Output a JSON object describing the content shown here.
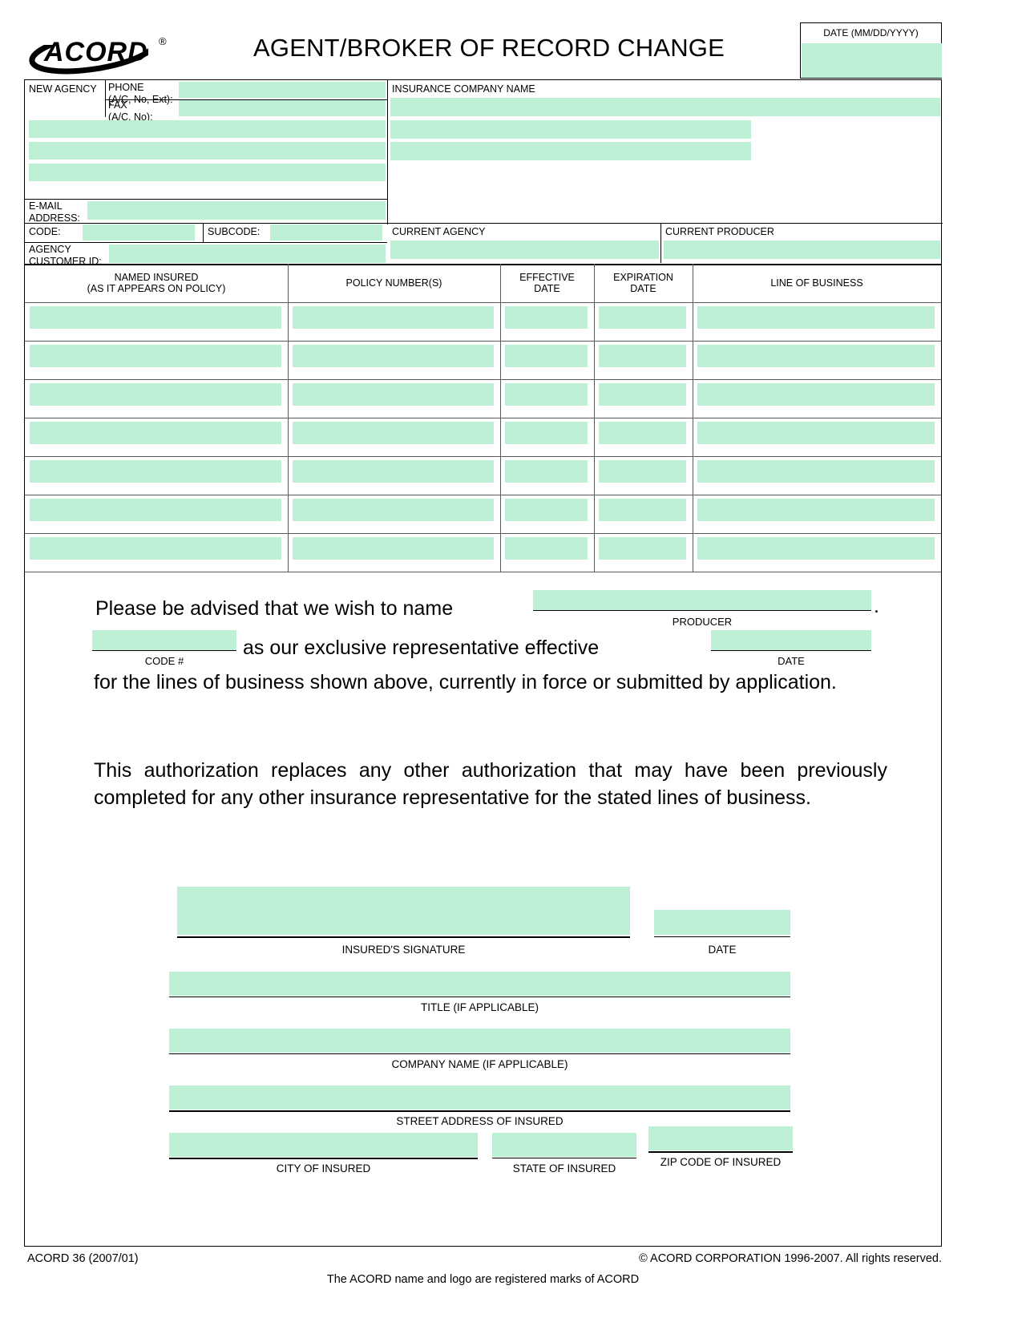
{
  "header": {
    "logo_text": "ACORD",
    "logo_reg": "®",
    "title": "AGENT/BROKER OF RECORD CHANGE",
    "date_label": "DATE (MM/DD/YYYY)",
    "date_value": ""
  },
  "agency": {
    "new_agency_label": "NEW AGENCY",
    "phone_label_l1": "PHONE",
    "phone_label_l2": "(A/C, No, Ext):",
    "phone_value": "",
    "fax_label_l1": "FAX",
    "fax_label_l2": "(A/C, No):",
    "fax_value": "",
    "address_line1": "",
    "address_line2": "",
    "address_line3": "",
    "email_label_l1": "E-MAIL",
    "email_label_l2": "ADDRESS:",
    "email_value": "",
    "code_label": "CODE:",
    "code_value": "",
    "subcode_label": "SUBCODE:",
    "subcode_value": "",
    "customer_id_label_l1": "AGENCY",
    "customer_id_label_l2": "CUSTOMER ID:",
    "customer_id_value": ""
  },
  "insurance": {
    "company_name_label": "INSURANCE COMPANY NAME",
    "company_name_value": "",
    "company_line2": "",
    "company_line3": "",
    "current_agency_label": "CURRENT AGENCY",
    "current_agency_value": "",
    "current_producer_label": "CURRENT PRODUCER",
    "current_producer_value": ""
  },
  "policy_table": {
    "columns": [
      {
        "label_l1": "NAMED INSURED",
        "label_l2": "(AS IT APPEARS ON POLICY)"
      },
      {
        "label_l1": "POLICY NUMBER(S)",
        "label_l2": ""
      },
      {
        "label_l1": "EFFECTIVE",
        "label_l2": "DATE"
      },
      {
        "label_l1": "EXPIRATION",
        "label_l2": "DATE"
      },
      {
        "label_l1": "LINE OF BUSINESS",
        "label_l2": ""
      }
    ],
    "rows": [
      {
        "named_insured": "",
        "policy_number": "",
        "effective_date": "",
        "expiration_date": "",
        "line_of_business": ""
      },
      {
        "named_insured": "",
        "policy_number": "",
        "effective_date": "",
        "expiration_date": "",
        "line_of_business": ""
      },
      {
        "named_insured": "",
        "policy_number": "",
        "effective_date": "",
        "expiration_date": "",
        "line_of_business": ""
      },
      {
        "named_insured": "",
        "policy_number": "",
        "effective_date": "",
        "expiration_date": "",
        "line_of_business": ""
      },
      {
        "named_insured": "",
        "policy_number": "",
        "effective_date": "",
        "expiration_date": "",
        "line_of_business": ""
      },
      {
        "named_insured": "",
        "policy_number": "",
        "effective_date": "",
        "expiration_date": "",
        "line_of_business": ""
      },
      {
        "named_insured": "",
        "policy_number": "",
        "effective_date": "",
        "expiration_date": "",
        "line_of_business": ""
      }
    ]
  },
  "statement": {
    "line1_text": "Please be advised that  we wish to name",
    "producer_value": "",
    "producer_label": "PRODUCER",
    "period": ".",
    "code_value": "",
    "code_label": "CODE #",
    "line2_text": "as our  exclusive representative  effective",
    "effective_date_value": "",
    "effective_date_label": "DATE",
    "line3_text": "for the lines of business shown above, currently in force or submitted by application.",
    "paragraph2": "This authorization replaces any other authorization that may have been previously completed for any other insurance representative for the stated lines of business."
  },
  "signature": {
    "insured_signature_value": "",
    "insured_signature_label": "INSURED'S SIGNATURE",
    "date_value": "",
    "date_label": "DATE",
    "title_value": "",
    "title_label": "TITLE (IF APPLICABLE)",
    "company_name_value": "",
    "company_name_label": "COMPANY NAME (IF APPLICABLE)",
    "street_address_value": "",
    "street_address_label": "STREET ADDRESS OF INSURED",
    "city_value": "",
    "city_label": "CITY OF INSURED",
    "state_value": "",
    "state_label": "STATE OF INSURED",
    "zip_value": "",
    "zip_label": "ZIP CODE OF INSURED"
  },
  "footer": {
    "form_id": "ACORD 36 (2007/01)",
    "copyright": "© ACORD CORPORATION 1996-2007.  All rights reserved.",
    "trademark": "The ACORD name and logo are registered marks of ACORD"
  },
  "colors": {
    "field_fill": "#bdf0d5",
    "rule": "#000000"
  }
}
